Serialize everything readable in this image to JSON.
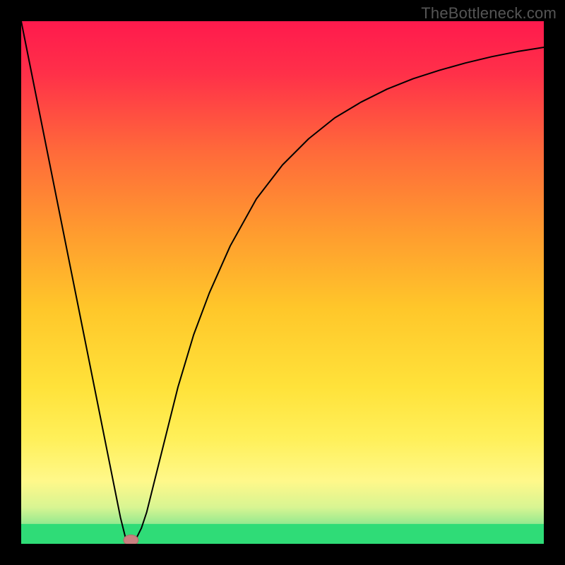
{
  "watermark": "TheBottleneck.com",
  "chart_data": {
    "type": "line",
    "title": "",
    "xlabel": "",
    "ylabel": "",
    "xlim": [
      0,
      100
    ],
    "ylim": [
      0,
      100
    ],
    "grid": false,
    "background": {
      "type": "vertical-gradient",
      "stops": [
        {
          "offset": 0.0,
          "color": "#ff1a4d"
        },
        {
          "offset": 0.1,
          "color": "#ff3049"
        },
        {
          "offset": 0.25,
          "color": "#ff6a3a"
        },
        {
          "offset": 0.4,
          "color": "#ff9a2f"
        },
        {
          "offset": 0.55,
          "color": "#ffc72a"
        },
        {
          "offset": 0.7,
          "color": "#ffe23a"
        },
        {
          "offset": 0.8,
          "color": "#fff05a"
        },
        {
          "offset": 0.88,
          "color": "#fff88a"
        },
        {
          "offset": 0.93,
          "color": "#d8f592"
        },
        {
          "offset": 0.965,
          "color": "#8fe88f"
        },
        {
          "offset": 1.0,
          "color": "#2fdc77"
        }
      ]
    },
    "series": [
      {
        "name": "bottleneck-curve",
        "stroke": "#000000",
        "stroke_width": 2.0,
        "x": [
          0.0,
          2.0,
          4.0,
          6.0,
          8.0,
          10.0,
          12.0,
          14.0,
          16.0,
          18.0,
          19.0,
          20.0,
          21.0,
          22.0,
          23.0,
          24.0,
          26.0,
          28.0,
          30.0,
          33.0,
          36.0,
          40.0,
          45.0,
          50.0,
          55.0,
          60.0,
          65.0,
          70.0,
          75.0,
          80.0,
          85.0,
          90.0,
          95.0,
          100.0
        ],
        "y": [
          100.0,
          90.0,
          80.0,
          70.0,
          60.0,
          50.0,
          40.0,
          30.0,
          20.0,
          10.0,
          5.0,
          1.0,
          0.5,
          1.0,
          3.0,
          6.0,
          14.0,
          22.0,
          30.0,
          40.0,
          48.0,
          57.0,
          66.0,
          72.5,
          77.5,
          81.5,
          84.5,
          87.0,
          89.0,
          90.6,
          92.0,
          93.2,
          94.2,
          95.0
        ]
      }
    ],
    "marker": {
      "name": "optimum-marker",
      "x": 21.0,
      "y": 0.7,
      "rx": 1.4,
      "ry": 1.0,
      "fill": "#c98080",
      "stroke": "#b26a6a"
    },
    "green_band": {
      "y_top": 3.8,
      "y_bottom": 0.0,
      "color": "#2fdc77"
    }
  }
}
